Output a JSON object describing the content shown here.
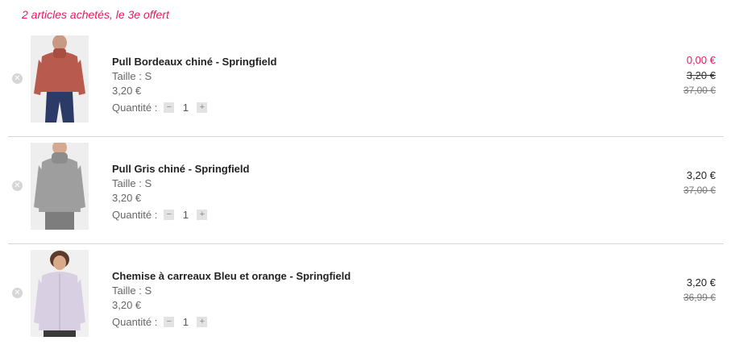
{
  "promo": "2 articles achetés, le 3e offert",
  "items": [
    {
      "name": "Pull Bordeaux chiné - Springfield",
      "size": "Taille : S",
      "unit_price": "3,20 €",
      "qty_label": "Quantité :",
      "qty": "1",
      "price_final": "0,00 €",
      "price_mid": "3,20 €",
      "price_old": "37,00 €",
      "image": {
        "sweater_color": "#b85b4e",
        "pants_color": "#2b3a67",
        "bg": "#eeeeee"
      }
    },
    {
      "name": "Pull Gris chiné - Springfield",
      "size": "Taille : S",
      "unit_price": "3,20 €",
      "qty_label": "Quantité :",
      "qty": "1",
      "price_final": "3,20 €",
      "price_old": "37,00 €",
      "image": {
        "sweater_color": "#9e9e9e",
        "pants_color": "#7d7d7d",
        "bg": "#eeeeee"
      }
    },
    {
      "name": "Chemise à carreaux Bleu et orange - Springfield",
      "size": "Taille : S",
      "unit_price": "3,20 €",
      "qty_label": "Quantité :",
      "qty": "1",
      "price_final": "3,20 €",
      "price_old": "36,99 €",
      "image": {
        "sweater_color": "#d9cfe3",
        "pants_color": "#3a3a3a",
        "bg": "#f0f0f0"
      }
    }
  ],
  "icons": {
    "remove": "close-icon",
    "minus": "minus-icon",
    "plus": "plus-icon"
  },
  "colors": {
    "accent": "#e6195f",
    "divider": "#d8d8d8"
  }
}
